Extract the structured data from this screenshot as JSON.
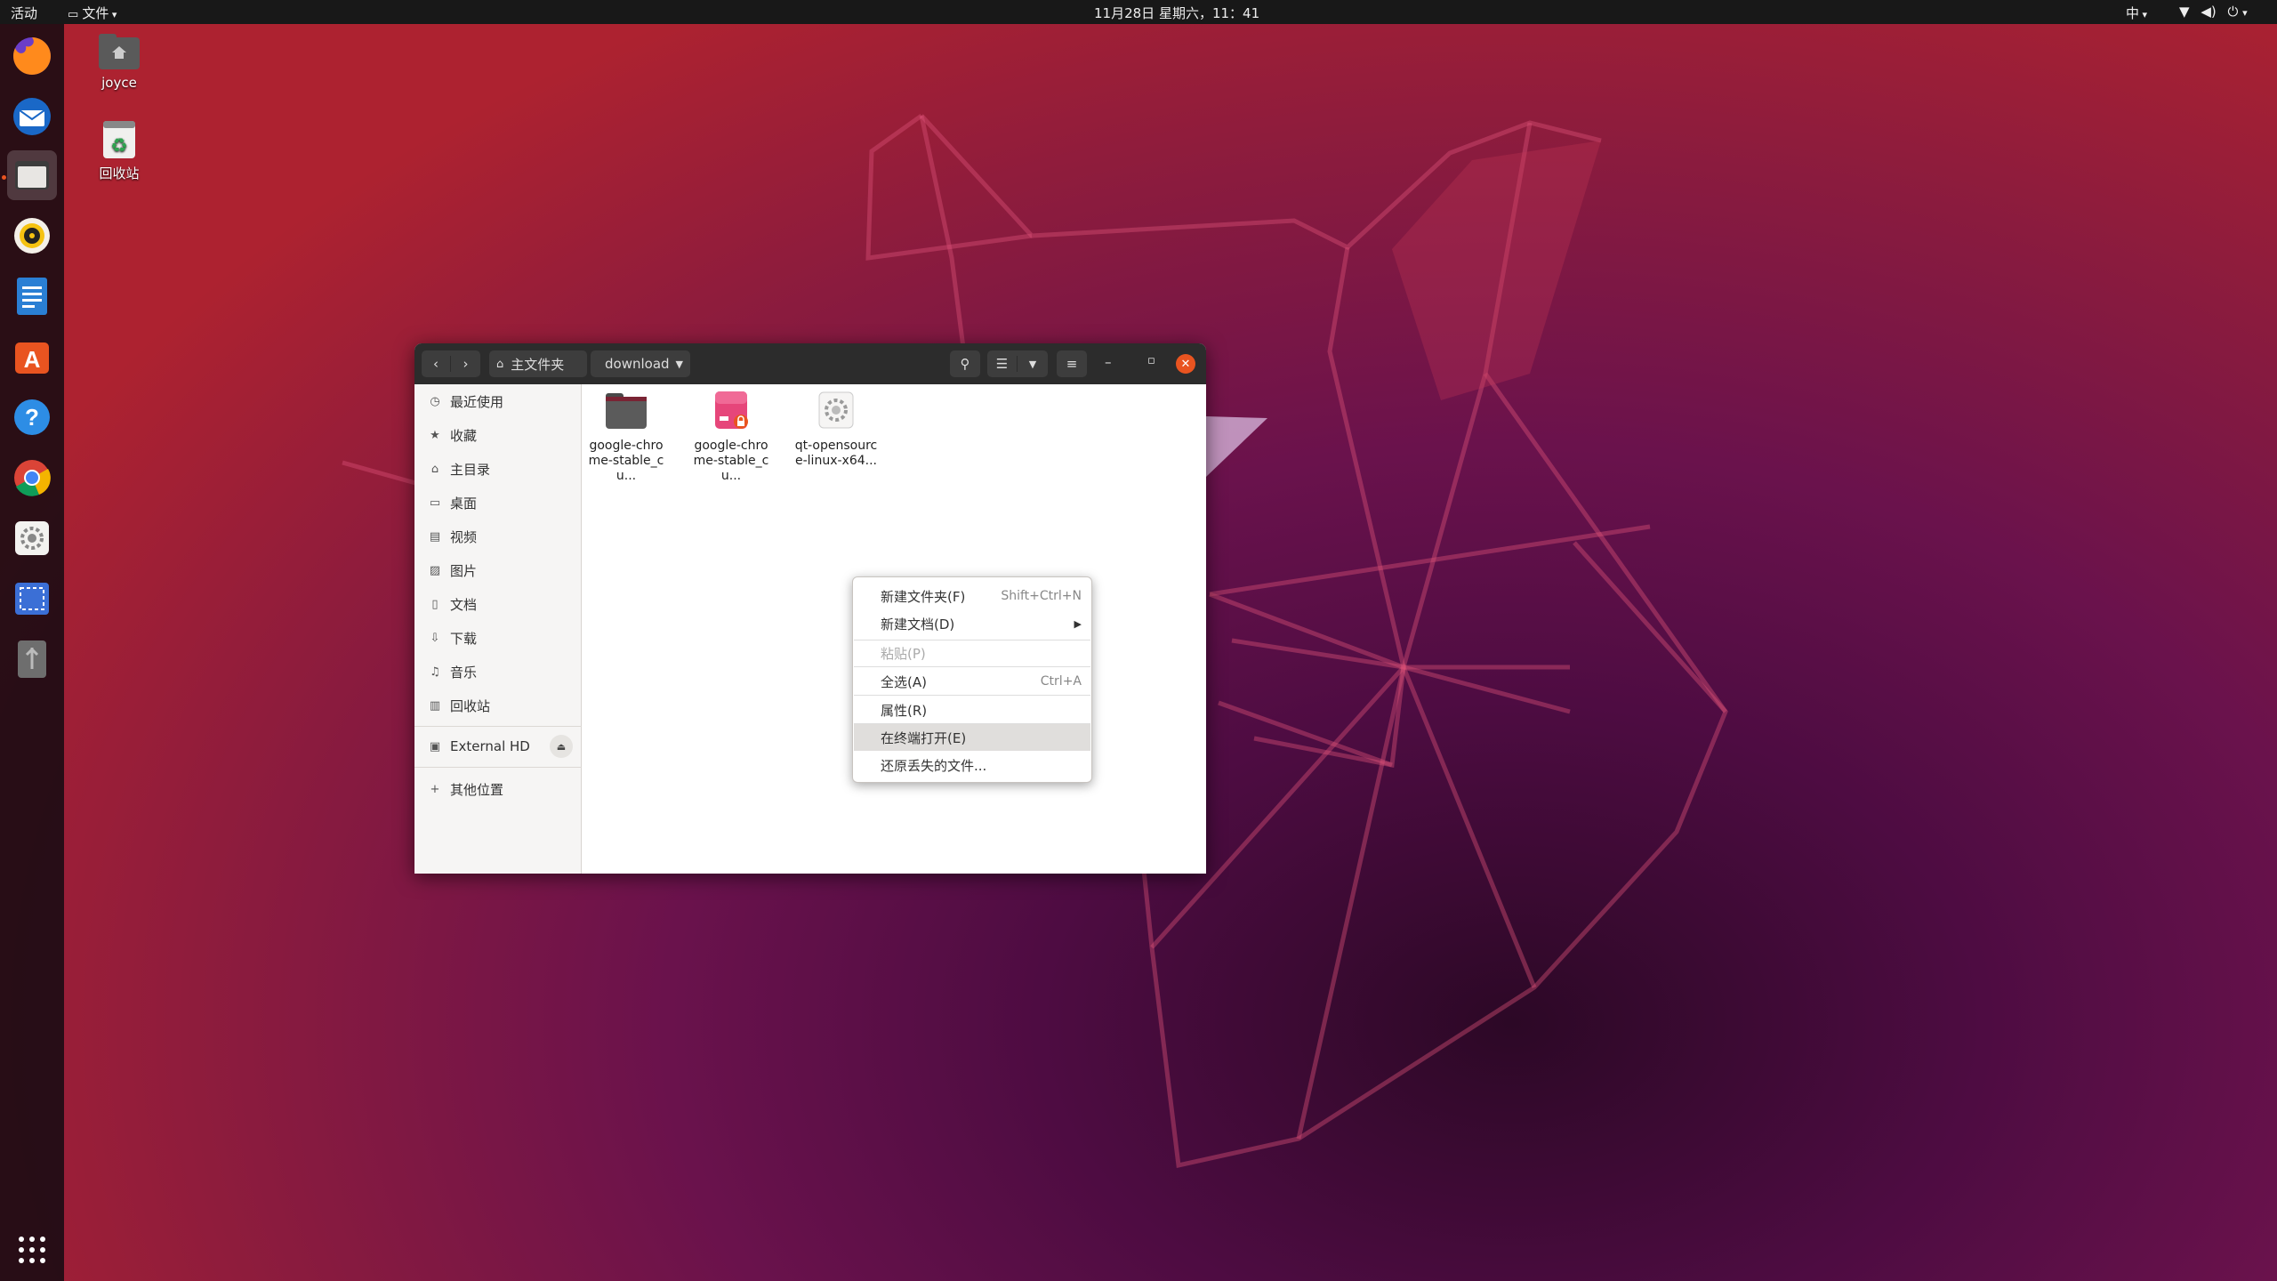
{
  "topbar": {
    "activities": "活动",
    "app_menu": "文件",
    "clock": "11月28日 星期六，11：41",
    "input_method": "中"
  },
  "desktop": {
    "home_label": "joyce",
    "trash_label": "回收站"
  },
  "dock": {
    "items": [
      "firefox-icon",
      "thunderbird-icon",
      "files-icon",
      "rhythmbox-icon",
      "writer-icon",
      "software-icon",
      "help-icon",
      "chrome-icon",
      "settings-icon",
      "screenshot-icon",
      "usb-icon"
    ],
    "active": "files-icon"
  },
  "window": {
    "path": {
      "home": "主文件夹",
      "current": "download"
    },
    "sidebar": {
      "items": [
        {
          "icon": "recent-icon",
          "label": "最近使用"
        },
        {
          "icon": "star-icon",
          "label": "收藏"
        },
        {
          "icon": "home-icon",
          "label": "主目录"
        },
        {
          "icon": "desktop-icon",
          "label": "桌面"
        },
        {
          "icon": "video-icon",
          "label": "视频"
        },
        {
          "icon": "picture-icon",
          "label": "图片"
        },
        {
          "icon": "document-icon",
          "label": "文档"
        },
        {
          "icon": "download-icon",
          "label": "下载"
        },
        {
          "icon": "music-icon",
          "label": "音乐"
        },
        {
          "icon": "trash-icon",
          "label": "回收站"
        }
      ],
      "device": "External HD",
      "other": "其他位置"
    },
    "files": [
      {
        "icon": "folder-icon",
        "label": "google-chrome-stable_cu..."
      },
      {
        "icon": "deb-package-icon",
        "label": "google-chrome-stable_cu..."
      },
      {
        "icon": "executable-icon",
        "label": "qt-opensource-linux-x64..."
      }
    ]
  },
  "context_menu": {
    "items": [
      {
        "label": "新建文件夹(F)",
        "shortcut": "Shift+Ctrl+N"
      },
      {
        "label": "新建文档(D)",
        "submenu": true
      },
      {
        "label": "粘贴(P)",
        "disabled": true
      },
      {
        "label": "全选(A)",
        "shortcut": "Ctrl+A"
      },
      {
        "label": "属性(R)"
      },
      {
        "label": "在终端打开(E)",
        "highlighted": true
      },
      {
        "label": "还原丢失的文件..."
      }
    ]
  },
  "colors": {
    "accent": "#e95420",
    "headerbar": "#2c2c2c",
    "topbar": "#181818"
  }
}
